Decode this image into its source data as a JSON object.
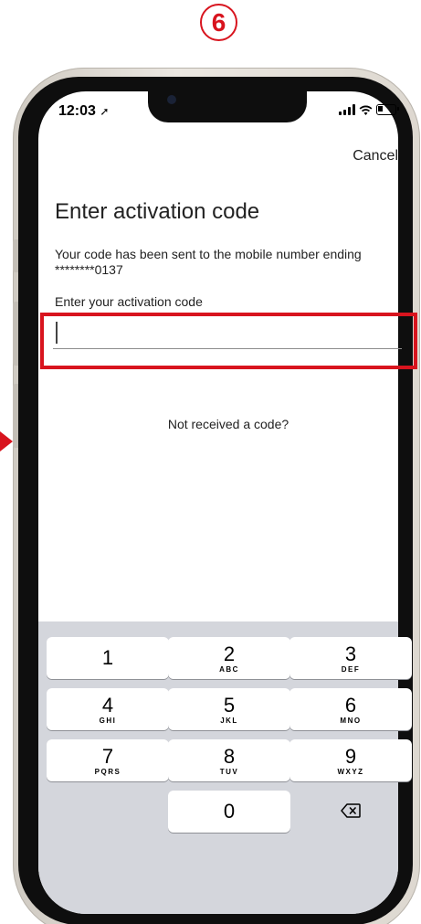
{
  "step_number": "6",
  "status_bar": {
    "time": "12:03"
  },
  "nav": {
    "cancel_label": "Cancel"
  },
  "content": {
    "title": "Enter activation code",
    "message": "Your code has been sent to the mobile number ending ********0137",
    "field_label": "Enter your activation code",
    "field_value": "",
    "not_received_label": "Not received a code?"
  },
  "keypad": {
    "keys": [
      {
        "num": "1",
        "letters": ""
      },
      {
        "num": "2",
        "letters": "ABC"
      },
      {
        "num": "3",
        "letters": "DEF"
      },
      {
        "num": "4",
        "letters": "GHI"
      },
      {
        "num": "5",
        "letters": "JKL"
      },
      {
        "num": "6",
        "letters": "MNO"
      },
      {
        "num": "7",
        "letters": "PQRS"
      },
      {
        "num": "8",
        "letters": "TUV"
      },
      {
        "num": "9",
        "letters": "WXYZ"
      },
      {
        "num": "0",
        "letters": ""
      }
    ],
    "delete_icon": "delete-backspace-icon"
  },
  "colors": {
    "highlight": "#d8141e",
    "keypad_background": "#d4d6dc"
  }
}
